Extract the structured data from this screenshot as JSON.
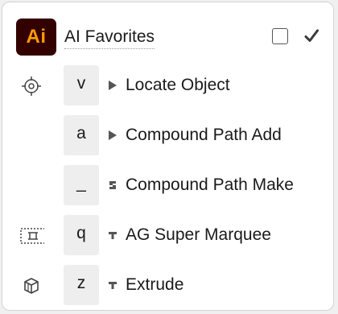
{
  "panel": {
    "logo_text": "Ai",
    "title": "AI Favorites"
  },
  "items": [
    {
      "key": "v",
      "label": "Locate Object",
      "icon": "crosshair-icon",
      "arrow": "triangle-right"
    },
    {
      "key": "a",
      "label": "Compound Path Add",
      "icon": "",
      "arrow": "triangle-right"
    },
    {
      "key": "_",
      "label": "Compound Path Make",
      "icon": "",
      "arrow": "stepped-marker"
    },
    {
      "key": "q",
      "label": "AG Super Marquee",
      "icon": "marquee-select-icon",
      "arrow": "tee-marker"
    },
    {
      "key": "z",
      "label": "Extrude",
      "icon": "cube-icon",
      "arrow": "tee-marker"
    }
  ]
}
